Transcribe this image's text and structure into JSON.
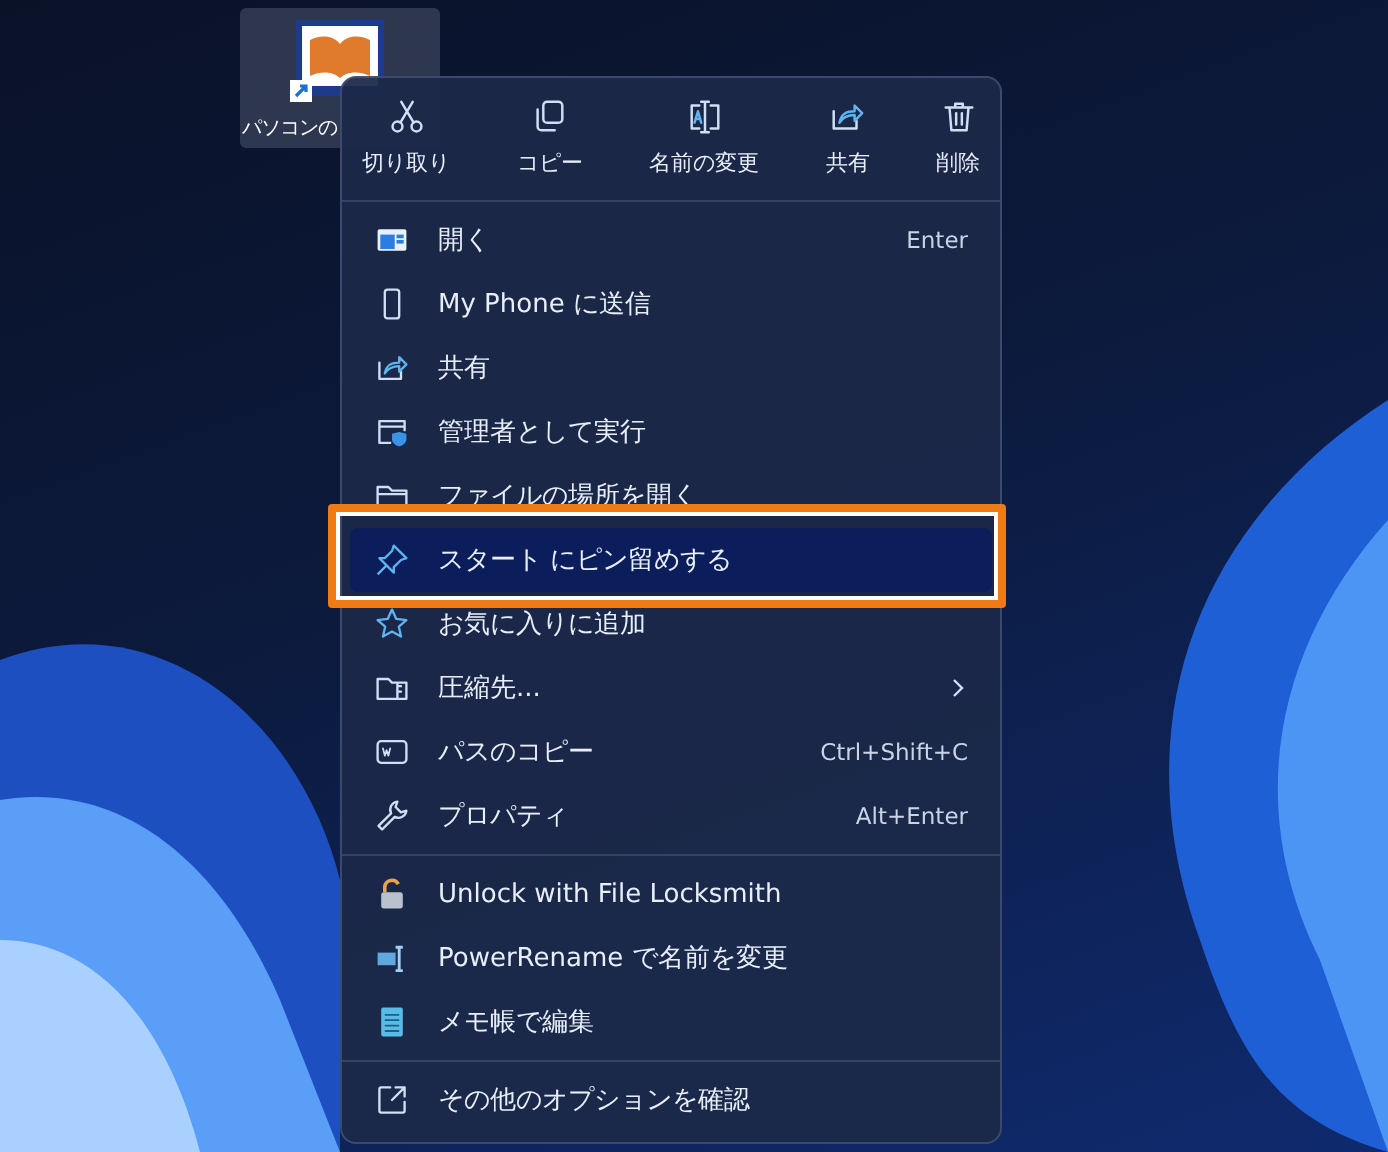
{
  "desktop_icon": {
    "label": "パソコンの"
  },
  "quick_actions": [
    {
      "label": "切り取り"
    },
    {
      "label": "コピー"
    },
    {
      "label": "名前の変更"
    },
    {
      "label": "共有"
    },
    {
      "label": "削除"
    }
  ],
  "menu": {
    "groups": [
      {
        "items": [
          {
            "kind": "item",
            "label": "開く",
            "shortcut": "Enter",
            "highlighted": false
          },
          {
            "kind": "item",
            "label": "My Phone に送信",
            "highlighted": false
          },
          {
            "kind": "item",
            "label": "共有",
            "highlighted": false
          },
          {
            "kind": "item",
            "label": "管理者として実行",
            "highlighted": false
          },
          {
            "kind": "item",
            "label": "ファイルの場所を開く",
            "highlighted": false
          },
          {
            "kind": "item",
            "label": "スタート にピン留めする",
            "highlighted": true
          },
          {
            "kind": "item",
            "label": "お気に入りに追加",
            "highlighted": false
          },
          {
            "kind": "submenu",
            "label": "圧縮先...",
            "highlighted": false
          },
          {
            "kind": "item",
            "label": "パスのコピー",
            "shortcut": "Ctrl+Shift+C",
            "highlighted": false
          },
          {
            "kind": "item",
            "label": "プロパティ",
            "shortcut": "Alt+Enter",
            "highlighted": false
          }
        ]
      },
      {
        "items": [
          {
            "kind": "item",
            "label": "Unlock with File Locksmith",
            "highlighted": false
          },
          {
            "kind": "item",
            "label": "PowerRename で名前を変更",
            "highlighted": false
          },
          {
            "kind": "item",
            "label": "メモ帳で編集",
            "highlighted": false
          }
        ]
      },
      {
        "items": [
          {
            "kind": "item",
            "label": "その他のオプションを確認",
            "highlighted": false
          }
        ]
      }
    ]
  }
}
